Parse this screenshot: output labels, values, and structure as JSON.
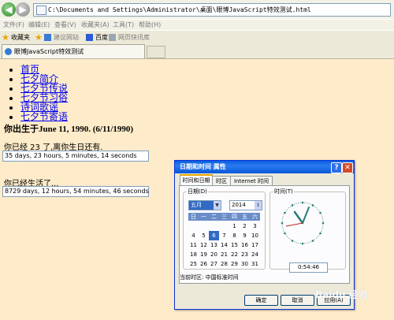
{
  "browser": {
    "address": "C:\\Documents and Settings\\Administrator\\桌面\\眼博JavaScript特效测试.html",
    "menu": [
      "文件(F)",
      "编辑(E)",
      "查看(V)",
      "收藏夹(A)",
      "工具(T)",
      "帮助(H)"
    ],
    "favorites_label": "收藏夹",
    "favbar": [
      "建议网站",
      "百度",
      "网页快讯库"
    ],
    "tab_title": "眼博JavaScript特效测试"
  },
  "page": {
    "nav_links": [
      "首页",
      "七夕简介",
      "七夕节传说",
      "七夕节习俗",
      "诗词歌谣",
      "七夕节寄语"
    ],
    "birth_line": "你出生于June 11, 1990. (6/11/1990)",
    "birthday_label": "你已经  23 了,离你生日还有.",
    "birthday_countdown": "35 days, 23 hours, 5 minutes, 14 seconds",
    "lived_label": "你已经生活了...",
    "lived_value": "8729 days, 12 hours, 54 minutes, 46 seconds"
  },
  "dialog": {
    "title": "日期和时间  属性",
    "help_btn": "?",
    "close_btn": "✕",
    "tabs": [
      "时间和日期",
      "时区",
      "Internet 时间"
    ],
    "date_group": "日期(D)",
    "month": "五月",
    "year": "2014",
    "weekdays": [
      "日",
      "一",
      "二",
      "三",
      "四",
      "五",
      "六"
    ],
    "weeks": [
      [
        "",
        "",
        "",
        "",
        "1",
        "2",
        "3"
      ],
      [
        "4",
        "5",
        "6",
        "7",
        "8",
        "9",
        "10"
      ],
      [
        "11",
        "12",
        "13",
        "14",
        "15",
        "16",
        "17"
      ],
      [
        "18",
        "19",
        "20",
        "21",
        "22",
        "23",
        "24"
      ],
      [
        "25",
        "26",
        "27",
        "28",
        "29",
        "30",
        "31"
      ]
    ],
    "selected_day": "6",
    "time_group": "时间(T)",
    "time": "0:54:46",
    "timezone": "当前时区: 中国标准时间",
    "ok": "确定",
    "cancel": "取消",
    "apply": "应用(A)"
  },
  "watermark": "Baidu 经验",
  "colors": {
    "page_bg": "#fdebc9",
    "link": "#0000ee",
    "titlebar": "#0a5ee0"
  }
}
